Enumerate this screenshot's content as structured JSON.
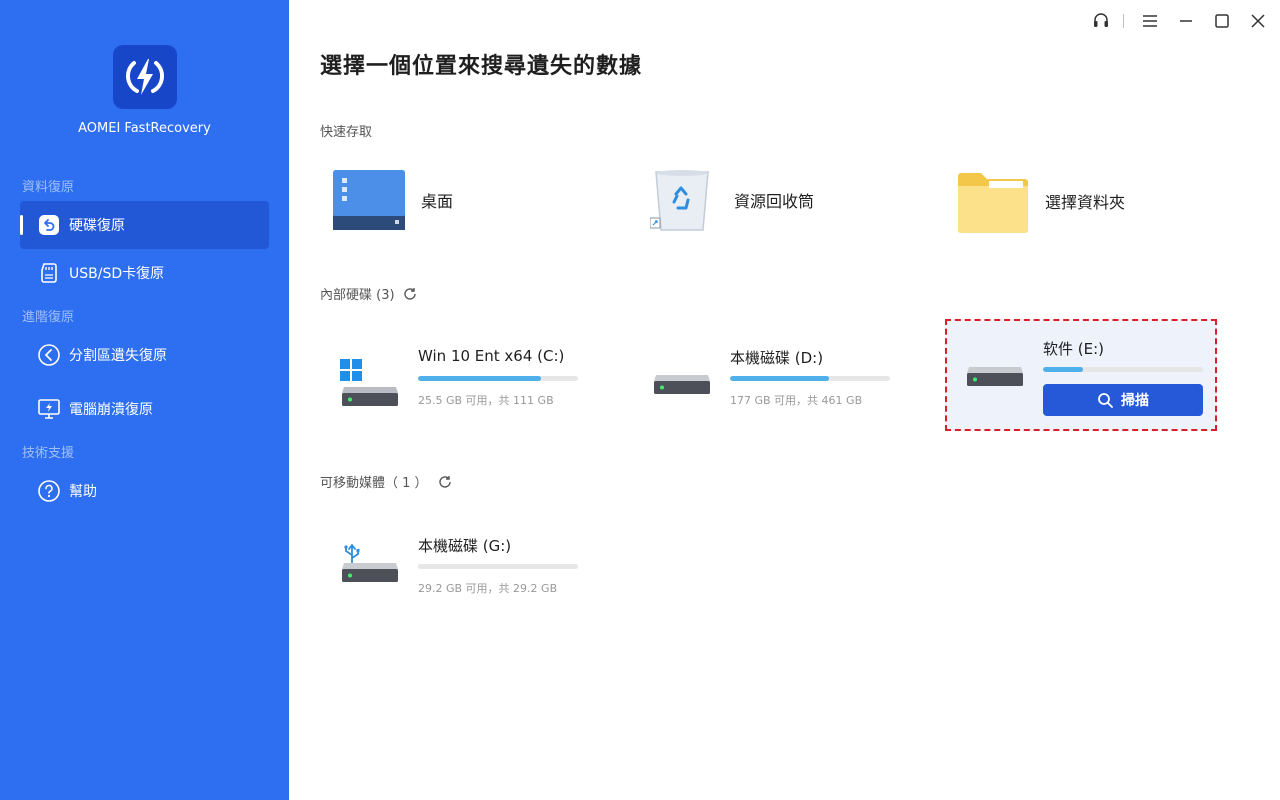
{
  "app": {
    "name": "AOMEI FastRecovery"
  },
  "sidebar": {
    "sections": [
      {
        "label": "資料復原"
      },
      {
        "label": "進階復原"
      },
      {
        "label": "技術支援"
      }
    ],
    "items": [
      {
        "label": "硬碟復原",
        "icon": "undo-icon",
        "active": true
      },
      {
        "label": "USB/SD卡復原",
        "icon": "sd-card-icon",
        "active": false
      },
      {
        "label": "分割區遺失復原",
        "icon": "partition-icon",
        "active": false
      },
      {
        "label": "電腦崩潰復原",
        "icon": "monitor-icon",
        "active": false
      },
      {
        "label": "幫助",
        "icon": "help-icon",
        "active": false
      }
    ]
  },
  "main": {
    "title": "選擇一個位置來搜尋遺失的數據",
    "quick_access": {
      "label": "快速存取",
      "items": [
        {
          "label": "桌面",
          "icon": "desktop-icon"
        },
        {
          "label": "資源回收筒",
          "icon": "recycle-bin-icon"
        },
        {
          "label": "選擇資料夾",
          "icon": "folder-icon"
        }
      ]
    },
    "internal": {
      "label": "內部硬碟 (3)",
      "drives": [
        {
          "name": "Win 10 Ent x64 (C:)",
          "space": "25.5 GB 可用，共 111 GB",
          "used_fraction": 0.77
        },
        {
          "name": "本機磁碟 (D:)",
          "space": "177 GB 可用，共 461 GB",
          "used_fraction": 0.62
        },
        {
          "name": "软件 (E:)",
          "used_fraction": 0.25,
          "scan_label": "掃描"
        }
      ]
    },
    "removable": {
      "label": "可移動媒體（ 1 ）",
      "drives": [
        {
          "name": "本機磁碟 (G:)",
          "space": "29.2 GB 可用，共 29.2 GB",
          "used_fraction": 0.0
        }
      ]
    }
  },
  "colors": {
    "sidebar": "#2d6ff0",
    "accent": "#2659d8",
    "progress": "#4fb0ea",
    "selection_border": "#d9202a"
  }
}
